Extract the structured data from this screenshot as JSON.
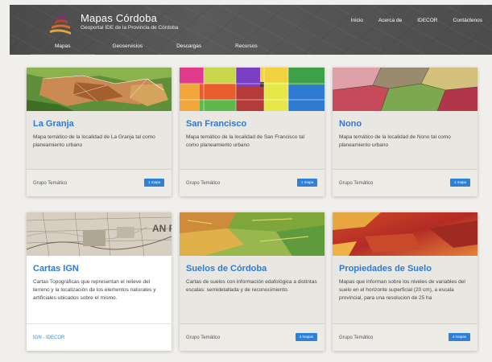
{
  "header": {
    "title": "Mapas Córdoba",
    "subtitle": "Geoportal IDE de la Provincia de Córdoba",
    "top_nav": [
      "Inicio",
      "Acerca de",
      "IDECOR",
      "Contáctenos"
    ],
    "tabs": [
      "Mapas",
      "Geoservicios",
      "Descargas",
      "Recursos"
    ],
    "active_tab": "Mapas"
  },
  "cards": [
    {
      "title": "La Granja",
      "desc": "Mapa temático de la localidad de La Granja tal como planeamiento urbano",
      "group": "Grupo Temático",
      "button": "1 mapa"
    },
    {
      "title": "San Francisco",
      "desc": "Mapa temático de la localidad de San Francisco tal como planeamiento urbano",
      "group": "Grupo Temático",
      "button": "1 mapa"
    },
    {
      "title": "Nono",
      "desc": "Mapa temático de la localidad de Nono tal como planeamiento urbano",
      "group": "Grupo Temático",
      "button": "1 mapa"
    },
    {
      "title": "Cartas IGN",
      "desc": "Cartas Topográficas que representan el relieve del terreno y la localización de los elementos naturales y artificiales ubicados sobre el mismo.",
      "group": "IGN - IDECOR",
      "button": ""
    },
    {
      "title": "Suelos de Córdoba",
      "desc": "Cartas de suelos con información edafológica a distintas escalas: semidetallada y de reconocimiento.",
      "group": "Grupo Temático",
      "button": "3 mapas"
    },
    {
      "title": "Propiedades de Suelo",
      "desc": "Mapas que informan sobre los niveles de variables del suelo en el horizonte superficial (20 cm), a escala provincial, para una resolucion de 25 ha",
      "group": "Grupo Temático",
      "button": "4 mapas"
    }
  ]
}
